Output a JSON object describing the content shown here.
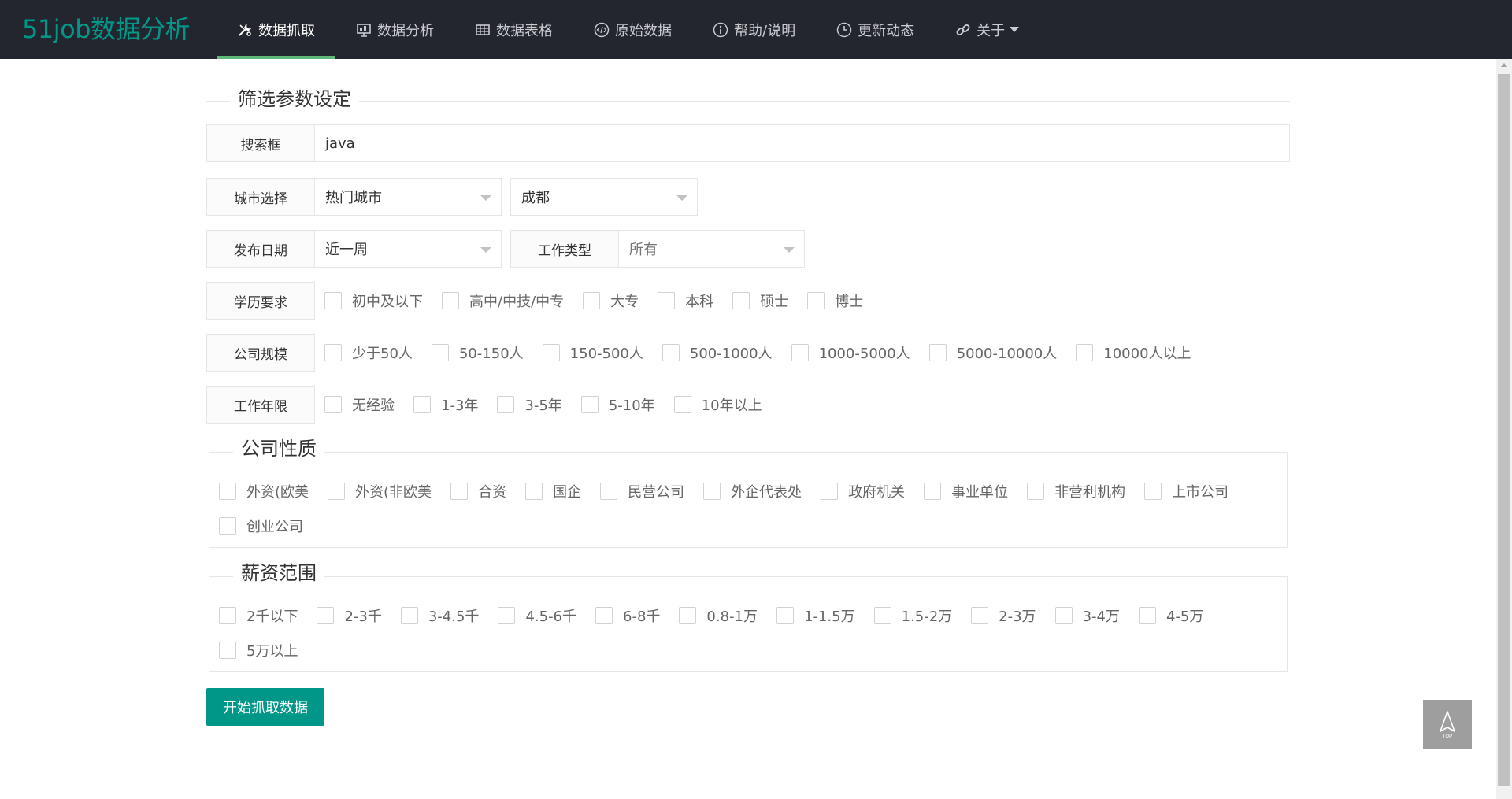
{
  "brand": {
    "logo": "51job数据分析",
    "accent": "#009688",
    "nav_active_bar": "#5fb878"
  },
  "nav": [
    {
      "label": "数据抓取",
      "icon": "tools-icon",
      "active": true
    },
    {
      "label": "数据分析",
      "icon": "presentation-icon",
      "active": false
    },
    {
      "label": "数据表格",
      "icon": "table-icon",
      "active": false
    },
    {
      "label": "原始数据",
      "icon": "code-icon",
      "active": false
    },
    {
      "label": "帮助/说明",
      "icon": "info-icon",
      "active": false
    },
    {
      "label": "更新动态",
      "icon": "clock-icon",
      "active": false
    },
    {
      "label": "关于",
      "icon": "link-icon",
      "active": false
    }
  ],
  "form": {
    "title": "筛选参数设定",
    "search": {
      "label": "搜索框",
      "value": "java"
    },
    "city": {
      "label": "城市选择",
      "category": "热门城市",
      "city": "成都"
    },
    "date": {
      "label": "发布日期",
      "value": "近一周"
    },
    "job_type": {
      "label": "工作类型",
      "value": "所有"
    },
    "education": {
      "label": "学历要求",
      "options": [
        "初中及以下",
        "高中/中技/中专",
        "大专",
        "本科",
        "硕士",
        "博士"
      ]
    },
    "company_size": {
      "label": "公司规模",
      "options": [
        "少于50人",
        "50-150人",
        "150-500人",
        "500-1000人",
        "1000-5000人",
        "5000-10000人",
        "10000人以上"
      ]
    },
    "experience": {
      "label": "工作年限",
      "options": [
        "无经验",
        "1-3年",
        "3-5年",
        "5-10年",
        "10年以上"
      ]
    },
    "company_type": {
      "label": "公司性质",
      "options": [
        "外资(欧美",
        "外资(非欧美",
        "合资",
        "国企",
        "民营公司",
        "外企代表处",
        "政府机关",
        "事业单位",
        "非营利机构",
        "上市公司",
        "创业公司"
      ]
    },
    "salary": {
      "label": "薪资范围",
      "options": [
        "2千以下",
        "2-3千",
        "3-4.5千",
        "4.5-6千",
        "6-8千",
        "0.8-1万",
        "1-1.5万",
        "1.5-2万",
        "2-3万",
        "3-4万",
        "4-5万",
        "5万以上"
      ]
    },
    "submit": "开始抓取数据"
  },
  "back_to_top": {
    "icon": "rocket-icon",
    "text": "TOP"
  }
}
